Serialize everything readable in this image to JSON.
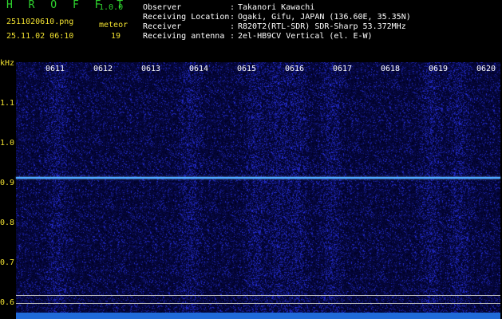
{
  "header": {
    "app_title": "H R O F F T",
    "app_version": "1.0.0",
    "file_name": "2511020610.png",
    "date_time": "25.11.02 06:10",
    "meteor_label": "meteor",
    "meteor_count": "19"
  },
  "info": {
    "observer_label": "Observer",
    "observer_value": "Takanori Kawachi",
    "location_label": "Receiving Location",
    "location_value": "Ogaki, Gifu, JAPAN (136.60E, 35.35N)",
    "receiver_label": "Receiver",
    "receiver_value": "R820T2(RTL-SDR) SDR-Sharp 53.372MHz",
    "antenna_label": "Receiving antenna",
    "antenna_value": "2el-HB9CV Vertical (el. E-W)",
    "colon": ":"
  },
  "axis": {
    "unit": "kHz",
    "y_ticks": [
      "1.1",
      "1.0",
      "0.9",
      "0.8",
      "0.7",
      "0.6"
    ],
    "time_labels": [
      "0611",
      "0612",
      "0613",
      "0614",
      "0615",
      "0616",
      "0617",
      "0618",
      "0619",
      "0620"
    ]
  },
  "colors": {
    "title_green": "#2fd62f",
    "label_yellow": "#f0e030",
    "signal_blue": "#4aa6ff",
    "background": "#000000"
  }
}
